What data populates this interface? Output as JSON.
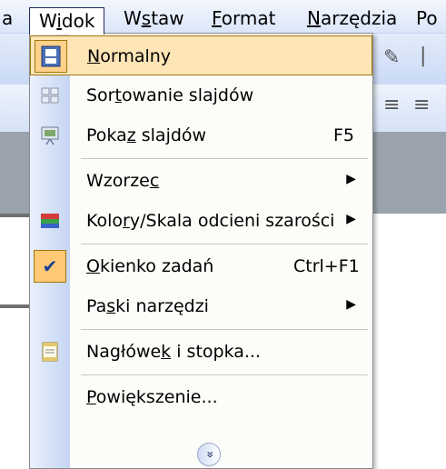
{
  "menubar": {
    "items": [
      {
        "label": "a",
        "underline": ""
      },
      {
        "label": "Widok",
        "underline": "i"
      },
      {
        "label": "Wstaw",
        "underline": "s"
      },
      {
        "label": "Format",
        "underline": "F"
      },
      {
        "label": "Narzędzia",
        "underline": "N"
      },
      {
        "label": "Po",
        "underline": ""
      }
    ]
  },
  "menu": {
    "items": [
      {
        "pre": "",
        "ul": "N",
        "post": "ormalny",
        "shortcut": "",
        "icon": "normal-view-icon",
        "submenu": false,
        "highlighted": true
      },
      {
        "pre": "Sor",
        "ul": "t",
        "post": "owanie slajdów",
        "shortcut": "",
        "icon": "slide-sorter-icon",
        "submenu": false
      },
      {
        "pre": "Poka",
        "ul": "z",
        "post": " slajdów",
        "shortcut": "F5",
        "icon": "slide-show-icon",
        "submenu": false
      },
      {
        "pre": "Wzorze",
        "ul": "c",
        "post": "",
        "shortcut": "",
        "icon": "",
        "submenu": true
      },
      {
        "pre": "Kolo",
        "ul": "r",
        "post": "y/Skala odcieni szarości",
        "shortcut": "",
        "icon": "color-grayscale-icon",
        "submenu": true
      },
      {
        "pre": "",
        "ul": "O",
        "post": "kienko zadań",
        "shortcut": "Ctrl+F1",
        "icon": "check-icon",
        "submenu": false,
        "checked": true
      },
      {
        "pre": "Pa",
        "ul": "s",
        "post": "ki narzędzi",
        "shortcut": "",
        "icon": "",
        "submenu": true
      },
      {
        "pre": "Nagłówe",
        "ul": "k",
        "post": " i stopka...",
        "shortcut": "",
        "icon": "header-footer-icon",
        "submenu": false
      },
      {
        "pre": "",
        "ul": "P",
        "post": "owiększenie...",
        "shortcut": "",
        "icon": "",
        "submenu": false
      }
    ],
    "expand_icon": "double-chevron-down-icon"
  },
  "colors": {
    "highlight_bg": "#fde5b6",
    "highlight_border": "#a0770e",
    "gutter_start": "#eaf0fc",
    "gutter_end": "#c5d5f2"
  }
}
